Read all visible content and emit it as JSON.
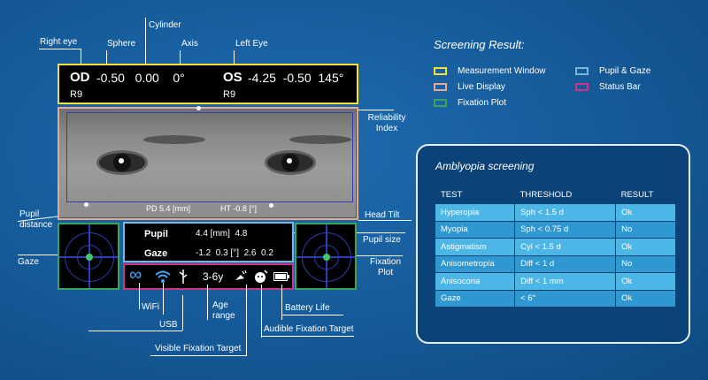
{
  "labels": {
    "right_eye": "Right eye",
    "sphere": "Sphere",
    "cylinder": "Cylinder",
    "axis": "Axis",
    "left_eye": "Left Eye",
    "reliability_index": "Reliability\nIndex",
    "pupil_distance": "Pupil\ndistance",
    "head_tilt": "Head Tilt",
    "pupil_size": "Pupil size",
    "gaze": "Gaze",
    "fixation_plot": "Fixation\nPlot",
    "wifi": "WiFi",
    "usb": "USB",
    "age_range": "Age\nrange",
    "battery_life": "Battery Life",
    "audible_fixation_target": "Audible Fixation Target",
    "visible_fixation_target": "Visible Fixation Target"
  },
  "measurement": {
    "od": "OD",
    "od_values": "-0.50   0.00    0°",
    "os": "OS",
    "os_values": "-4.25  -0.50  145°",
    "od_reliability": "R9",
    "os_reliability": "R9"
  },
  "live": {
    "pd": "PD 5.4 [mm]",
    "ht": "HT  -0.8 [°]"
  },
  "pupil_panel": {
    "pupil_label": "Pupil",
    "pupil_values": "4.4 [mm]  4.8",
    "gaze_label": "Gaze",
    "gaze_values": "-1.2  0.3 [°]  2.6  0.2"
  },
  "status": {
    "age": "3-6y"
  },
  "screening_result": {
    "title": "Screening Result:",
    "legend": [
      {
        "label": "Measurement Window",
        "color": "#f2e23a"
      },
      {
        "label": "Live Display",
        "color": "#e2a995"
      },
      {
        "label": "Fixation Plot",
        "color": "#39a55a"
      },
      {
        "label": "Pupil & Gaze",
        "color": "#7fb3d8"
      },
      {
        "label": "Status Bar",
        "color": "#d2338a"
      }
    ]
  },
  "amblyopia": {
    "title": "Amblyopia screening",
    "headers": [
      "TEST",
      "THRESHOLD",
      "RESULT"
    ],
    "rows": [
      [
        "Hyperopia",
        "Sph < 1.5 d",
        "Ok"
      ],
      [
        "Myopia",
        "Sph < 0.75 d",
        "No"
      ],
      [
        "Astigmatism",
        "Cyl < 1.5 d",
        "Ok"
      ],
      [
        "Anisometropia",
        "Diff < 1 d",
        "No"
      ],
      [
        "Anisocoria",
        "Diff < 1 mm",
        "Ok"
      ],
      [
        "Gaze",
        "< 6°",
        "Ok"
      ]
    ]
  },
  "icons": [
    "infinity-icon",
    "wifi-icon",
    "usb-icon",
    "visible-target-icon",
    "audible-target-icon",
    "battery-icon"
  ]
}
